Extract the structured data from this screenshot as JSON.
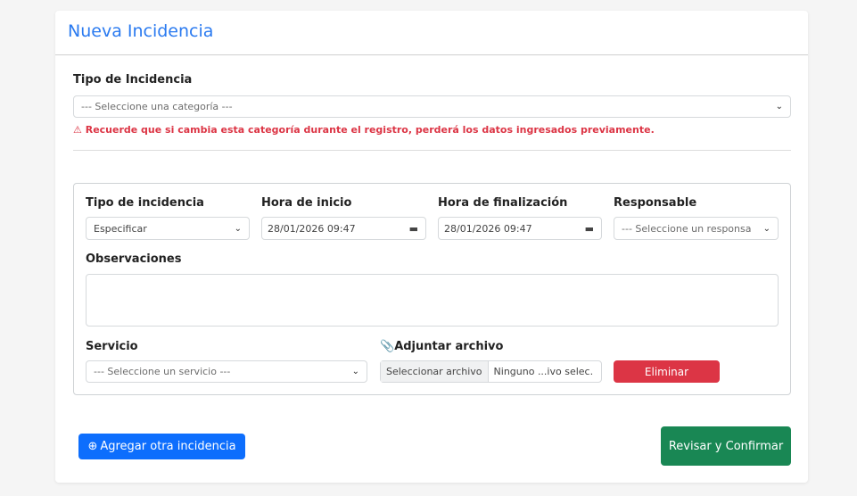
{
  "header": {
    "title": "Nueva Incidencia"
  },
  "category": {
    "label": "Tipo de Incidencia",
    "placeholder": "--- Seleccione una categoría ---",
    "warning": "Recuerde que si cambia esta categoría durante el registro, perderá los datos ingresados previamente."
  },
  "incident": {
    "type_label": "Tipo de incidencia",
    "type_value": "Especificar",
    "start_label": "Hora de inicio",
    "start_value": "28/01/2026 09:47",
    "end_label": "Hora de finalización",
    "end_value": "28/01/2026 09:47",
    "owner_label": "Responsable",
    "owner_placeholder": "--- Seleccione un responsa",
    "notes_label": "Observaciones",
    "service_label": "Servicio",
    "service_placeholder": "--- Seleccione un servicio ---",
    "attach_label": "Adjuntar archivo",
    "file_button": "Seleccionar archivo",
    "file_status": "Ninguno ...ivo selec.",
    "delete_label": "Eliminar"
  },
  "actions": {
    "add_label": "Agregar otra incidencia",
    "confirm_label": "Revisar y Confirmar"
  },
  "colors": {
    "primary": "#0d6efd",
    "danger": "#dc3545",
    "success": "#198754"
  }
}
